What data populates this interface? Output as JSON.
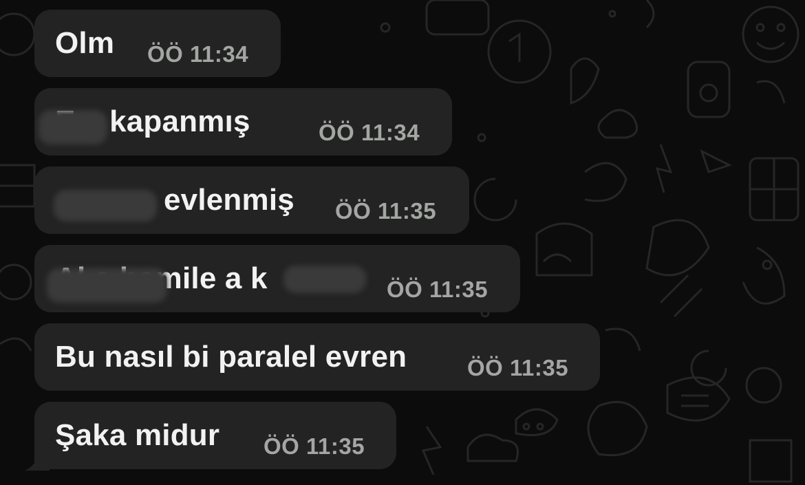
{
  "messages": [
    {
      "text": "Olm",
      "time": "ÖÖ 11:34"
    },
    {
      "text": "E a kapanmış",
      "time": "ÖÖ 11:34"
    },
    {
      "text": "evlenmiş",
      "time": "ÖÖ 11:35"
    },
    {
      "text": "Al a hamile a k",
      "time": "ÖÖ 11:35"
    },
    {
      "text": "Bu nasıl bi paralel evren",
      "time": "ÖÖ 11:35"
    },
    {
      "text": "Şaka midur",
      "time": "ÖÖ 11:35"
    }
  ],
  "colors": {
    "background": "#0c0c0c",
    "bubble": "#222322",
    "text": "#f2f2f2",
    "time": "#a4a6a4"
  }
}
